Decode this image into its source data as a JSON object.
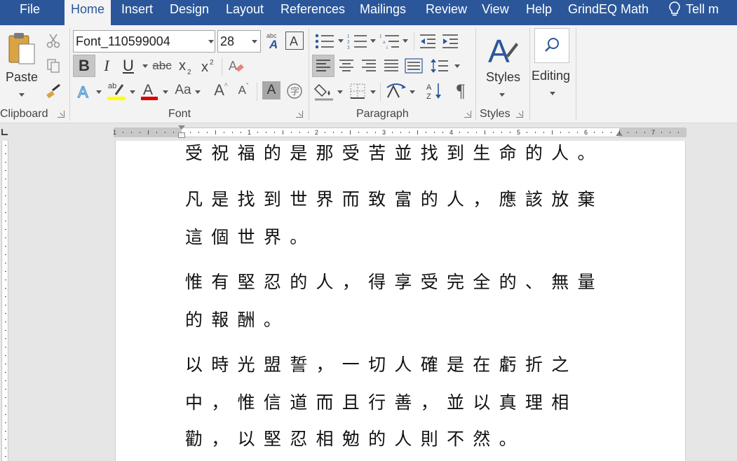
{
  "tabs": [
    "File",
    "Home",
    "Insert",
    "Design",
    "Layout",
    "References",
    "Mailings",
    "Review",
    "View",
    "Help",
    "GrindEQ Math",
    "Tell m"
  ],
  "ribbon": {
    "groups": {
      "clipboard": "Clipboard",
      "font": "Font",
      "paragraph": "Paragraph",
      "styles": "Styles"
    },
    "paste_label": "Paste",
    "font_name": "Font_110599004",
    "font_size": "28",
    "styles_label": "Styles",
    "editing_label": "Editing",
    "change_case_label": "Aa",
    "grow_font_label": "A",
    "shrink_font_label": "A",
    "bold_label": "B",
    "italic_label": "I",
    "underline_label": "U",
    "strike_label": "abc",
    "clear_format_label": "A",
    "char_shading_label": "A",
    "pilcrow": "¶",
    "highlight_color": "#ffff00",
    "font_color": "#e00000",
    "accent": "#2b579a"
  },
  "ruler": {
    "numbers": [
      "1",
      "1",
      "2",
      "3",
      "4",
      "5",
      "6",
      "7"
    ]
  },
  "document": {
    "lines": [
      "受祝福的是那受苦並找到生命的人。",
      "凡是找到世界而致富的人，應該放棄",
      "這個世界。",
      "惟有堅忍的人，得享受完全的、無量",
      "的報酬。",
      "以時光盟誓，一切人確是在虧折之",
      "中，惟信道而且行善，並以真理相",
      "勸，以堅忍相勉的人則不然。"
    ]
  }
}
